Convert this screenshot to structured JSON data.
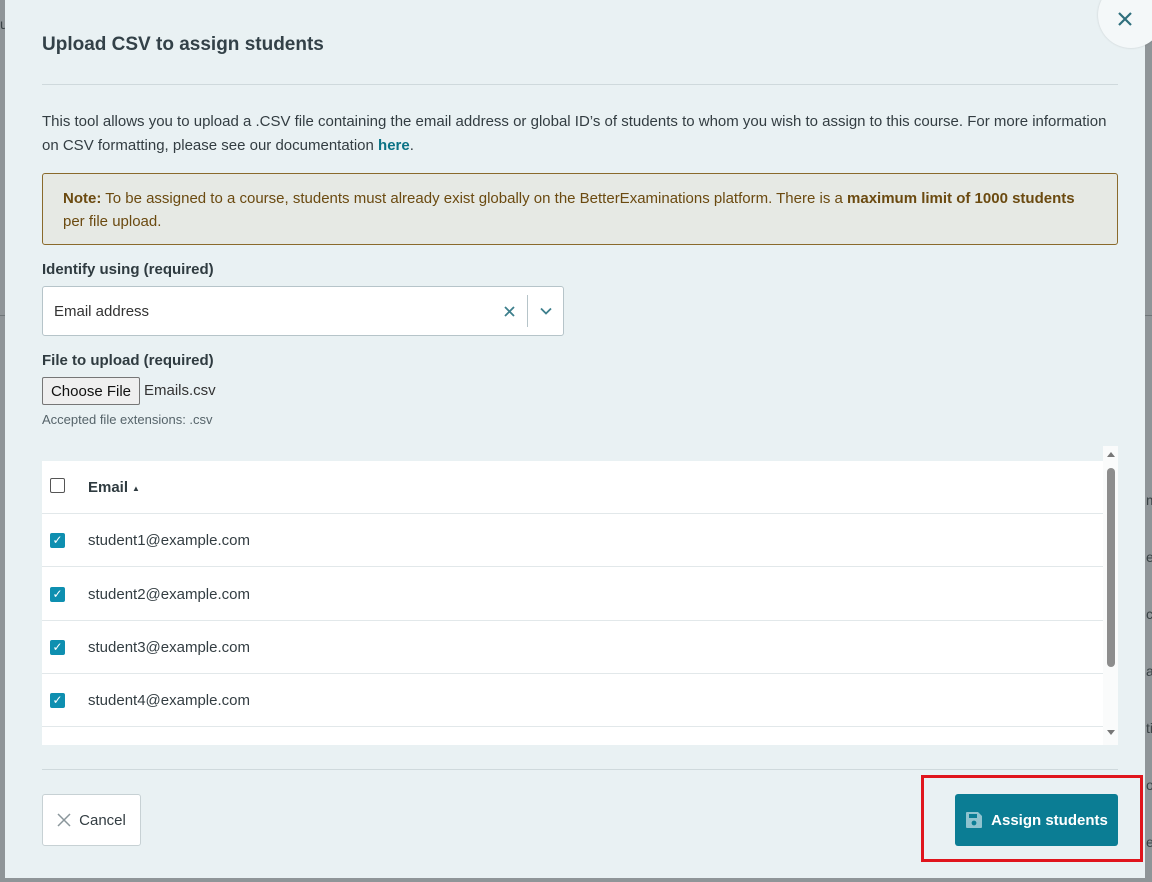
{
  "background": {
    "fragments": [
      "u",
      "m",
      "e",
      "ct",
      "a",
      "ti",
      "on",
      "e"
    ]
  },
  "modal": {
    "title": "Upload CSV to assign students",
    "description_text": "This tool allows you to upload a .CSV file containing the email address or global ID’s of students to whom you wish to assign to this course. For more information on CSV formatting, please see our documentation ",
    "description_link": "here",
    "description_end": ".",
    "note": {
      "lead": "Note:",
      "text1": " To be assigned to a course, students must already exist globally on the BetterExaminations platform. There is a ",
      "strong": "maximum limit of 1000 students",
      "text2": " per file upload."
    },
    "identify": {
      "label": "Identify using (required)",
      "value": "Email address"
    },
    "file": {
      "label": "File to upload (required)",
      "button": "Choose File",
      "filename": "Emails.csv",
      "hint": "Accepted file extensions: .csv"
    },
    "table": {
      "header": "Email",
      "header_checked": false,
      "rows": [
        {
          "email": "student1@example.com",
          "checked": true
        },
        {
          "email": "student2@example.com",
          "checked": true
        },
        {
          "email": "student3@example.com",
          "checked": true
        },
        {
          "email": "student4@example.com",
          "checked": true
        }
      ]
    },
    "footer": {
      "cancel": "Cancel",
      "assign": "Assign students"
    }
  },
  "colors": {
    "accent": "#0b7d94",
    "checkbox": "#0e8fb0",
    "highlight": "#e0151c"
  }
}
